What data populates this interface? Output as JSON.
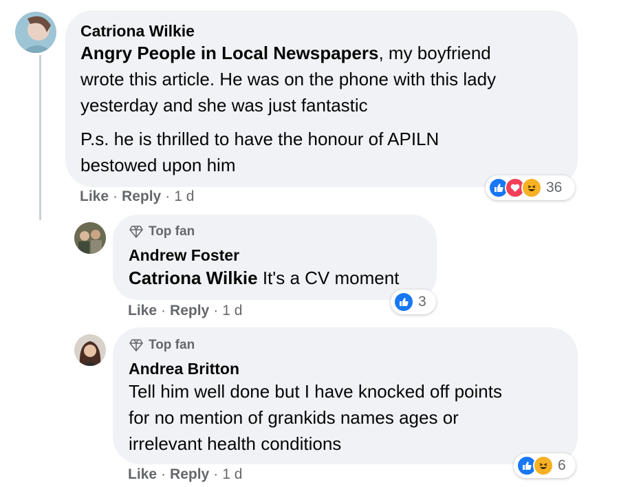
{
  "comments": [
    {
      "author": "Catriona Wilkie",
      "mention": "Angry People in Local Newspapers",
      "text_line1": ", my boyfriend",
      "text_line2": "wrote this article. He was on the phone with this lady",
      "text_line3": "yesterday and she was just fantastic",
      "text_line4": "P.s. he is thrilled to have the honour of APILN",
      "text_line5": "bestowed upon him",
      "like_label": "Like",
      "reply_label": "Reply",
      "time": "1 d",
      "reaction_count": "36",
      "reactions": [
        "like",
        "love",
        "haha"
      ]
    },
    {
      "badge": "Top fan",
      "author": "Andrew Foster",
      "mention": "Catriona Wilkie",
      "text": " It's a CV moment",
      "like_label": "Like",
      "reply_label": "Reply",
      "time": "1 d",
      "reaction_count": "3",
      "reactions": [
        "like"
      ]
    },
    {
      "badge": "Top fan",
      "author": "Andrea Britton",
      "text_line1": "Tell him well done but I have knocked off points",
      "text_line2": "for no mention of grankids names ages or",
      "text_line3": "irrelevant health conditions",
      "like_label": "Like",
      "reply_label": "Reply",
      "time": "1 d",
      "reaction_count": "6",
      "reactions": [
        "like",
        "haha"
      ]
    }
  ],
  "separator": "·"
}
